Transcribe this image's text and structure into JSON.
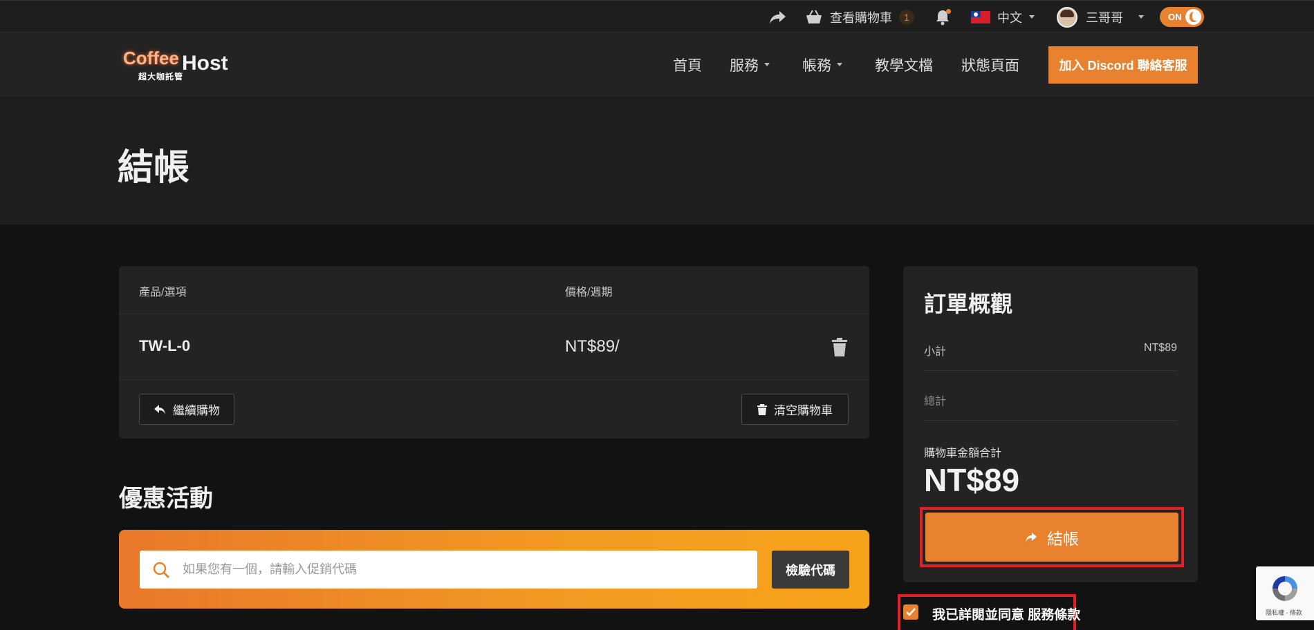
{
  "topbar": {
    "cart_label": "查看購物車",
    "cart_count": "1",
    "language": "中文",
    "username": "三哥哥",
    "theme_toggle": "ON"
  },
  "header": {
    "logo_brand": "Coffee",
    "logo_host": "Host",
    "logo_tagline": "超大咖託管",
    "nav": {
      "home": "首頁",
      "services": "服務",
      "account": "帳務",
      "docs": "教學文檔",
      "status": "狀態頁面"
    },
    "discord_button": "加入 Discord 聯絡客服"
  },
  "page": {
    "title": "結帳"
  },
  "cart": {
    "col_product": "產品/選項",
    "col_price": "價格/週期",
    "items": [
      {
        "product": "TW-L-0",
        "price": "NT$89/"
      }
    ],
    "continue_button": "繼續購物",
    "empty_button": "清空購物車"
  },
  "promo": {
    "title": "優惠活動",
    "placeholder": "如果您有一個，請輸入促銷代碼",
    "validate_button": "檢驗代碼"
  },
  "summary": {
    "title": "訂單概觀",
    "subtotal_label": "小計",
    "subtotal_value": "NT$89",
    "total_label": "總計",
    "cart_total_label": "購物車金額合計",
    "cart_total_value": "NT$89",
    "checkout_button": "結帳"
  },
  "terms": {
    "label": "我已詳閱並同意 服務條款"
  },
  "recaptcha": {
    "text": "隱私權 - 條款"
  },
  "colors": {
    "accent": "#e8822e",
    "highlight_border": "#e21f26",
    "background": "#121212"
  }
}
